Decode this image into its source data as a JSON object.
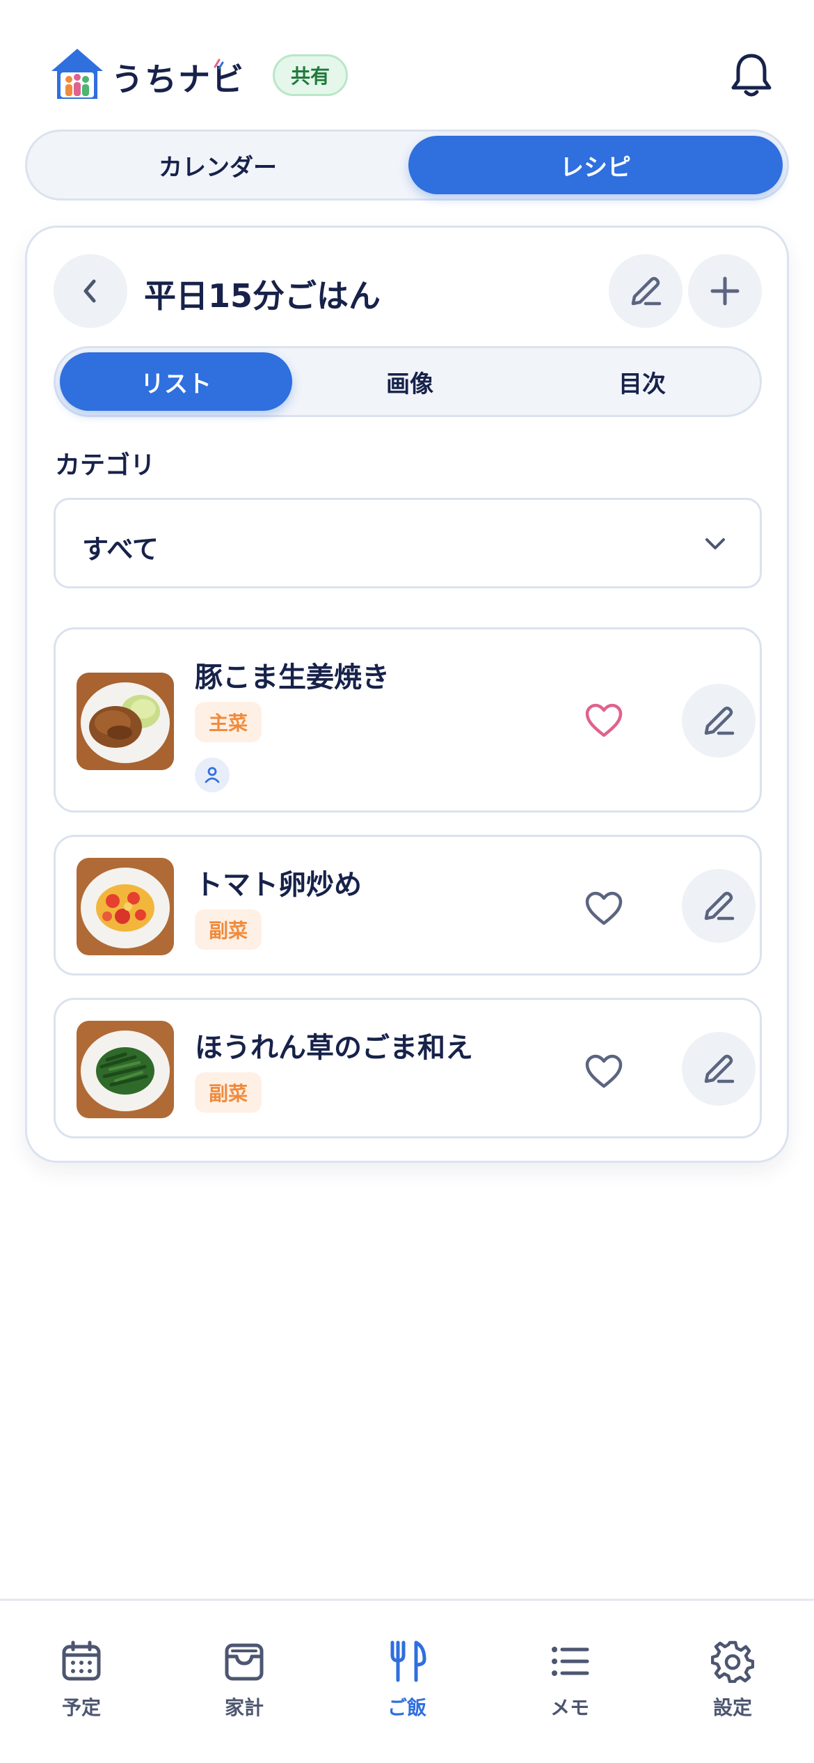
{
  "header": {
    "app_title": "うちナビ",
    "shared_badge": "共有"
  },
  "main_tabs": [
    {
      "label": "カレンダー",
      "active": false
    },
    {
      "label": "レシピ",
      "active": true
    }
  ],
  "recipe_book": {
    "title": "平日15分ごはん",
    "view_tabs": [
      {
        "label": "リスト",
        "active": true
      },
      {
        "label": "画像",
        "active": false
      },
      {
        "label": "目次",
        "active": false
      }
    ],
    "category_label": "カテゴリ",
    "category_value": "すべて",
    "items": [
      {
        "name": "豚こま生姜焼き",
        "tag": "主菜",
        "favorite": true,
        "has_user": true
      },
      {
        "name": "トマト卵炒め",
        "tag": "副菜",
        "favorite": false,
        "has_user": false
      },
      {
        "name": "ほうれん草のごま和え",
        "tag": "副菜",
        "favorite": false,
        "has_user": false
      }
    ]
  },
  "bottom_nav": [
    {
      "label": "予定",
      "icon": "calendar-icon",
      "active": false
    },
    {
      "label": "家計",
      "icon": "wallet-icon",
      "active": false
    },
    {
      "label": "ご飯",
      "icon": "fork-knife-icon",
      "active": true
    },
    {
      "label": "メモ",
      "icon": "list-icon",
      "active": false
    },
    {
      "label": "設定",
      "icon": "gear-icon",
      "active": false
    }
  ],
  "colors": {
    "accent": "#2f6fde",
    "text": "#17224a",
    "tag_bg": "#fff0e6",
    "tag_text": "#f08b3c",
    "favorite": "#e0628f",
    "badge_bg": "#e4f7ea",
    "badge_text": "#1f7a3a"
  }
}
